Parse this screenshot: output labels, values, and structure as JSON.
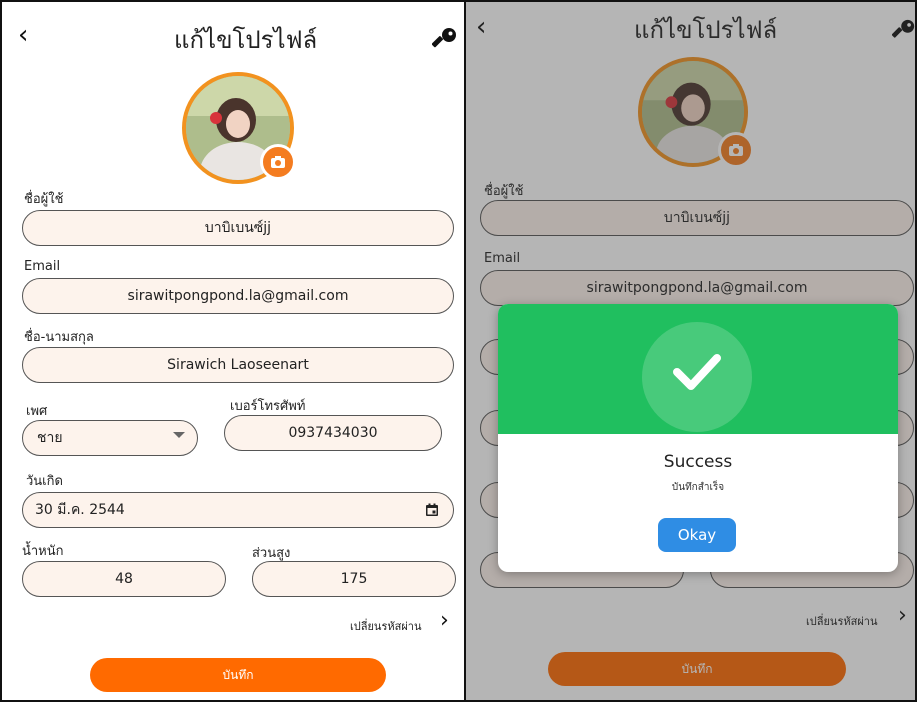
{
  "left": {
    "title": "แก้ไขโปรไฟล์",
    "username_label": "ชื่อผู้ใช้",
    "username_value": "บาบิเบนซ์jj",
    "email_label": "Email",
    "email_value": "sirawitpongpond.la@gmail.com",
    "fullname_label": "ชื่อ-นามสกุล",
    "fullname_value": "Sirawich Laoseenart",
    "gender_label": "เพศ",
    "gender_value": "ชาย",
    "phone_label": "เบอร์โทรศัพท์",
    "phone_value": "0937434030",
    "birthdate_label": "วันเกิด",
    "birthdate_value": "30 มี.ค. 2544",
    "weight_label": "น้ำหนัก",
    "weight_value": "48",
    "height_label": "ส่วนสูง",
    "height_value": "175",
    "change_password": "เปลี่ยนรหัสผ่าน",
    "save": "บันทึก"
  },
  "right": {
    "title": "แก้ไขโปรไฟล์",
    "username_label": "ชื่อผู้ใช้",
    "username_value": "บาบิเบนซ์jj",
    "email_label": "Email",
    "email_value": "sirawitpongpond.la@gmail.com",
    "change_password": "เปลี่ยนรหัสผ่าน",
    "save": "บันทึก",
    "dialog": {
      "title": "Success",
      "message": "บันทึกสำเร็จ",
      "ok": "Okay"
    }
  },
  "colors": {
    "accent": "#ff6a00",
    "avatar_ring": "#f2921f",
    "field_bg": "#fdf3ec",
    "success": "#20bf5f",
    "ok_button": "#2f8de4"
  },
  "icons": [
    "back-icon",
    "key-icon",
    "camera-icon",
    "dropdown-icon",
    "calendar-icon",
    "chevron-right-icon",
    "check-icon"
  ]
}
